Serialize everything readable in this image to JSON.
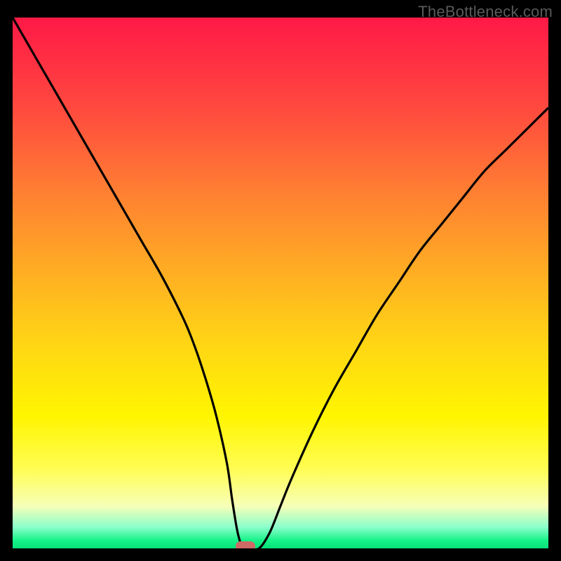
{
  "watermark": "TheBottleneck.com",
  "chart_data": {
    "type": "line",
    "title": "",
    "xlabel": "",
    "ylabel": "",
    "xlim": [
      0,
      100
    ],
    "ylim": [
      0,
      100
    ],
    "grid": false,
    "x": [
      0,
      4,
      8,
      12,
      16,
      20,
      24,
      28,
      32,
      34,
      36,
      38,
      40,
      41,
      42,
      43,
      44,
      46,
      48,
      50,
      52,
      56,
      60,
      64,
      68,
      72,
      76,
      80,
      84,
      88,
      92,
      96,
      100
    ],
    "y": [
      100,
      93,
      86,
      79,
      72,
      65,
      58,
      51,
      43,
      38,
      32,
      25,
      16,
      9,
      3,
      0,
      0,
      0,
      3,
      8,
      13,
      22,
      30,
      37,
      44,
      50,
      56,
      61,
      66,
      71,
      75,
      79,
      83
    ],
    "marker": {
      "x": 43.5,
      "y": 0
    },
    "background_gradient": {
      "stops": [
        {
          "pos": 0,
          "color": "#ff1946"
        },
        {
          "pos": 18,
          "color": "#ff4c3e"
        },
        {
          "pos": 47,
          "color": "#ffab24"
        },
        {
          "pos": 75,
          "color": "#fff500"
        },
        {
          "pos": 92,
          "color": "#f7ffb7"
        },
        {
          "pos": 100,
          "color": "#06e279"
        }
      ]
    }
  }
}
